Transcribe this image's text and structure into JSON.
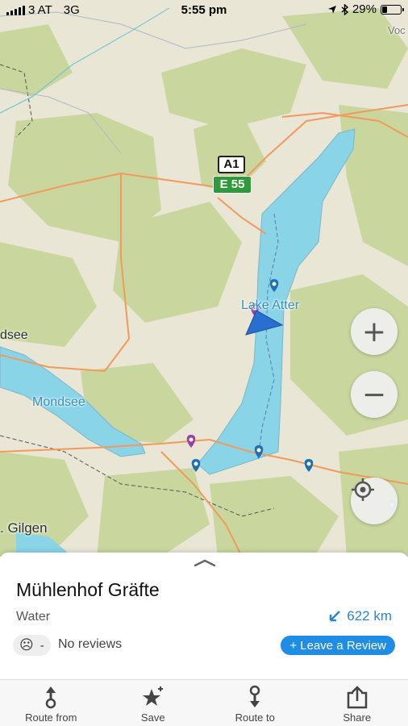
{
  "status_bar": {
    "carrier": "3 AT",
    "network": "3G",
    "time": "5:55 pm",
    "battery": "29%",
    "battery_level": 0.29
  },
  "map": {
    "labels": {
      "lake_atter": "Lake Atter",
      "mondsee": "Mondsee",
      "mondsee_town": "dsee",
      "st_gilgen": ". Gilgen",
      "edge_label": "Voc"
    },
    "shields": {
      "motorway": "A1",
      "euro_route": "E 55"
    },
    "buttons": {
      "zoom_in": "+",
      "zoom_out": "−"
    }
  },
  "place": {
    "title": "Mühlenhof Gräfte",
    "type": "Water",
    "distance": "622 km",
    "rating_face": "☹",
    "rating_value": "-",
    "reviews": "No reviews",
    "leave_review": "+ Leave a Review"
  },
  "tabs": [
    {
      "label": "Route from",
      "icon": "route-from-icon"
    },
    {
      "label": "Save",
      "icon": "star-add-icon"
    },
    {
      "label": "Route to",
      "icon": "route-to-icon"
    },
    {
      "label": "Share",
      "icon": "share-icon"
    }
  ],
  "colors": {
    "accent": "#1f8ce6",
    "water": "#8ad4e8",
    "forest": "#c9d79f",
    "land": "#e9e6d6",
    "road": "#f19a5b",
    "pin_blue": "#1e6fb3",
    "pin_purple": "#9b3fa8"
  }
}
